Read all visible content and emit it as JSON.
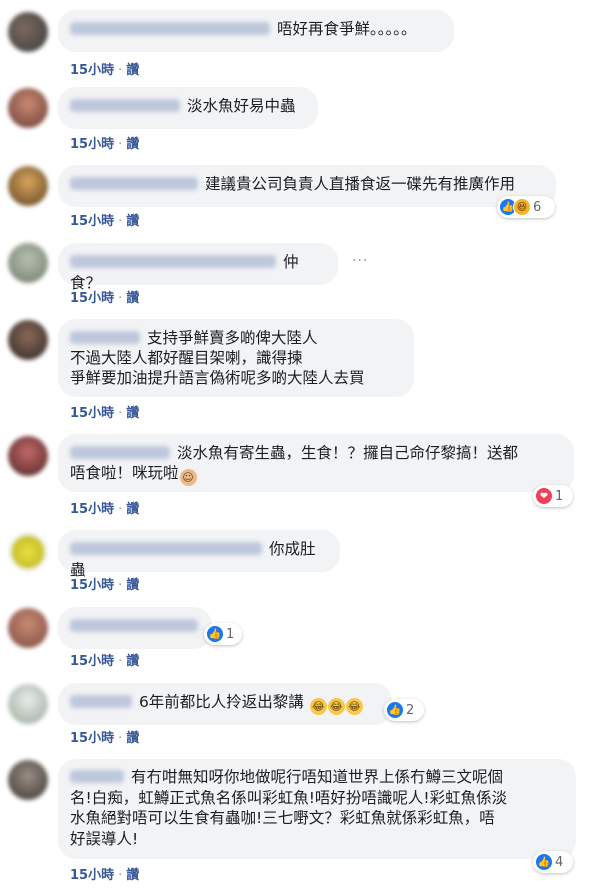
{
  "meta": {
    "time": "15小時",
    "dot": "·",
    "like": "讚"
  },
  "comments": [
    {
      "text": "唔好再食爭鮮。。。。。"
    },
    {
      "text": "淡水魚好易中蟲"
    },
    {
      "text": "建議貴公司負責人直播食返一碟先有推廣作用",
      "reaction_count": "6"
    },
    {
      "text": "仲食？",
      "more": "···"
    },
    {
      "lines": [
        "支持爭鮮賣多啲俾大陸人",
        "不過大陸人都好醒目架喇，識得揀",
        "爭鮮要加油提升語言偽術呢多啲大陸人去買"
      ]
    },
    {
      "lines": [
        "淡水魚有寄生蟲，生食！？攞自己命仔黎搞！送都",
        "唔食啦！咪玩啦"
      ],
      "emoji": "☺",
      "reaction_count": "1"
    },
    {
      "text": "你成肚蟲"
    },
    {
      "text": "",
      "reaction_count": "1"
    },
    {
      "text": "6年前都比人拎返出黎講",
      "emoji": "😂",
      "reaction_count": "2"
    },
    {
      "lines": [
        "有冇咁無知呀你地做呢行唔知道世界上係冇鱒三文呢個",
        "名!白痴，虹鱒正式魚名係叫彩虹魚!唔好扮唔識呢人!彩虹魚係淡",
        "水魚絕對唔可以生食有蟲咖!三七嘢文？彩虹魚就係彩虹魚，唔",
        "好誤導人!"
      ],
      "reaction_count": "4"
    }
  ],
  "colors": {
    "bubble": "#f2f3f5",
    "link": "#385898",
    "like": "#1877f2",
    "love": "#f33e58"
  }
}
